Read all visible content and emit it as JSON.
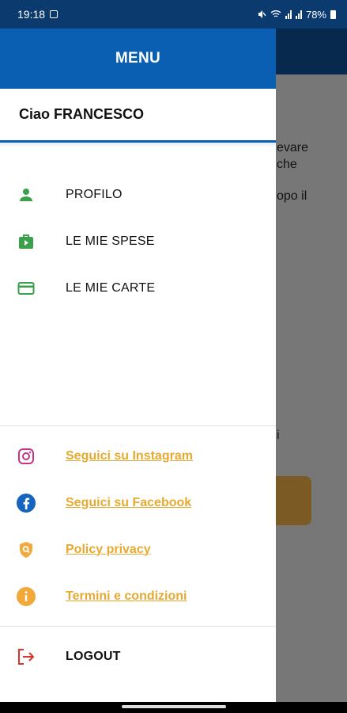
{
  "status_bar": {
    "time": "19:18",
    "battery": "78%",
    "icons": [
      "image-icon",
      "mute-icon",
      "wifi-icon",
      "signal-icon",
      "signal-icon",
      "battery-icon"
    ]
  },
  "background_app": {
    "text_fragments": [
      "evare",
      "che",
      "opo il",
      "i"
    ]
  },
  "drawer": {
    "title": "MENU",
    "greeting": "Ciao FRANCESCO",
    "items": [
      {
        "label": "PROFILO",
        "icon": "person-icon",
        "color": "#3aa14a"
      },
      {
        "label": "LE MIE SPESE",
        "icon": "shopping-bag-icon",
        "color": "#3aa14a"
      },
      {
        "label": "LE MIE CARTE",
        "icon": "credit-card-icon",
        "color": "#3aa14a"
      }
    ],
    "links": [
      {
        "label": "Seguici su Instagram",
        "icon": "instagram-icon",
        "color": "#c13584"
      },
      {
        "label": "Seguici su Facebook",
        "icon": "facebook-icon",
        "color": "#1565c0"
      },
      {
        "label": "Policy privacy",
        "icon": "shield-search-icon",
        "color": "#f0a93a"
      },
      {
        "label": "Termini e condizioni",
        "icon": "info-icon",
        "color": "#f0a93a"
      }
    ],
    "logout": {
      "label": "LOGOUT",
      "icon": "logout-icon",
      "color": "#d9342b"
    }
  },
  "colors": {
    "header_blue": "#0b5fb3",
    "link_orange": "#e8a930",
    "icon_green": "#3aa14a"
  }
}
